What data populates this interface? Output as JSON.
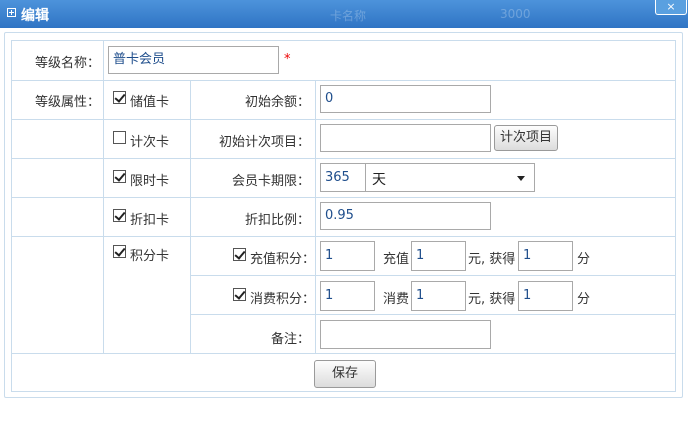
{
  "window": {
    "title": "编辑",
    "ghost_text_1": "卡名称",
    "ghost_text_2": "3000",
    "close": "×"
  },
  "form": {
    "level_name": {
      "label": "等级名称：",
      "value": "普卡会员",
      "required_mark": "*"
    },
    "level_attrs_label": "等级属性：",
    "options": [
      {
        "label": "储值卡",
        "checked": true
      },
      {
        "label": "计次卡",
        "checked": false
      },
      {
        "label": "限时卡",
        "checked": true
      },
      {
        "label": "折扣卡",
        "checked": true
      },
      {
        "label": "积分卡",
        "checked": true
      }
    ],
    "initial_balance": {
      "label": "初始余额：",
      "value": "0"
    },
    "initial_count_items": {
      "label": "初始计次项目：",
      "value": "",
      "button": "计次项目"
    },
    "validity": {
      "label": "会员卡期限：",
      "value": "365",
      "unit": "天"
    },
    "discount": {
      "label": "折扣比例：",
      "value": "0.95"
    },
    "recharge_points": {
      "label": "充值积分：",
      "checked": true,
      "value": "1",
      "recharge_label": "充值",
      "recharge_value": "1",
      "yuan_get": "元, 获得",
      "points_value": "1",
      "points_unit": "分"
    },
    "consume_points": {
      "label": "消费积分：",
      "checked": true,
      "value": "1",
      "consume_label": "消费",
      "consume_value": "1",
      "yuan_get": "元, 获得",
      "points_value": "1",
      "points_unit": "分"
    },
    "remark": {
      "label": "备注：",
      "value": ""
    },
    "save_button": "保存"
  }
}
